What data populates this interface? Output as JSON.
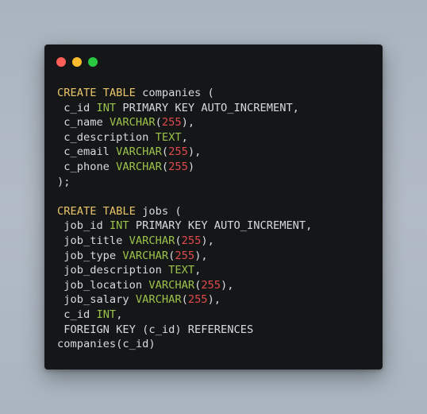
{
  "window": {
    "controls": [
      {
        "name": "close",
        "color": "#ff5f57"
      },
      {
        "name": "minimize",
        "color": "#febc2e"
      },
      {
        "name": "maximize",
        "color": "#28c840"
      }
    ]
  },
  "colors": {
    "keyword": "#e8c46a",
    "type": "#9bc24a",
    "number": "#e04b4b",
    "text": "#d7dade",
    "background": "#151618"
  },
  "code": {
    "lines": [
      [
        {
          "t": "kw",
          "v": "CREATE TABLE"
        },
        {
          "t": "pl",
          "v": " companies ("
        }
      ],
      [
        {
          "t": "pl",
          "v": " c_id "
        },
        {
          "t": "ty",
          "v": "INT"
        },
        {
          "t": "pl",
          "v": " PRIMARY KEY AUTO_INCREMENT,"
        }
      ],
      [
        {
          "t": "pl",
          "v": " c_name "
        },
        {
          "t": "ty",
          "v": "VARCHAR"
        },
        {
          "t": "pl",
          "v": "("
        },
        {
          "t": "num",
          "v": "255"
        },
        {
          "t": "pl",
          "v": "),"
        }
      ],
      [
        {
          "t": "pl",
          "v": " c_description "
        },
        {
          "t": "ty",
          "v": "TEXT"
        },
        {
          "t": "pl",
          "v": ","
        }
      ],
      [
        {
          "t": "pl",
          "v": " c_email "
        },
        {
          "t": "ty",
          "v": "VARCHAR"
        },
        {
          "t": "pl",
          "v": "("
        },
        {
          "t": "num",
          "v": "255"
        },
        {
          "t": "pl",
          "v": "),"
        }
      ],
      [
        {
          "t": "pl",
          "v": " c_phone "
        },
        {
          "t": "ty",
          "v": "VARCHAR"
        },
        {
          "t": "pl",
          "v": "("
        },
        {
          "t": "num",
          "v": "255"
        },
        {
          "t": "pl",
          "v": ")"
        }
      ],
      [
        {
          "t": "pl",
          "v": ");"
        }
      ],
      [],
      [
        {
          "t": "kw",
          "v": "CREATE TABLE"
        },
        {
          "t": "pl",
          "v": " jobs ("
        }
      ],
      [
        {
          "t": "pl",
          "v": " job_id "
        },
        {
          "t": "ty",
          "v": "INT"
        },
        {
          "t": "pl",
          "v": " PRIMARY KEY AUTO_INCREMENT,"
        }
      ],
      [
        {
          "t": "pl",
          "v": " job_title "
        },
        {
          "t": "ty",
          "v": "VARCHAR"
        },
        {
          "t": "pl",
          "v": "("
        },
        {
          "t": "num",
          "v": "255"
        },
        {
          "t": "pl",
          "v": "),"
        }
      ],
      [
        {
          "t": "pl",
          "v": " job_type "
        },
        {
          "t": "ty",
          "v": "VARCHAR"
        },
        {
          "t": "pl",
          "v": "("
        },
        {
          "t": "num",
          "v": "255"
        },
        {
          "t": "pl",
          "v": "),"
        }
      ],
      [
        {
          "t": "pl",
          "v": " job_description "
        },
        {
          "t": "ty",
          "v": "TEXT"
        },
        {
          "t": "pl",
          "v": ","
        }
      ],
      [
        {
          "t": "pl",
          "v": " job_location "
        },
        {
          "t": "ty",
          "v": "VARCHAR"
        },
        {
          "t": "pl",
          "v": "("
        },
        {
          "t": "num",
          "v": "255"
        },
        {
          "t": "pl",
          "v": "),"
        }
      ],
      [
        {
          "t": "pl",
          "v": " job_salary "
        },
        {
          "t": "ty",
          "v": "VARCHAR"
        },
        {
          "t": "pl",
          "v": "("
        },
        {
          "t": "num",
          "v": "255"
        },
        {
          "t": "pl",
          "v": "),"
        }
      ],
      [
        {
          "t": "pl",
          "v": " c_id "
        },
        {
          "t": "ty",
          "v": "INT"
        },
        {
          "t": "pl",
          "v": ","
        }
      ],
      [
        {
          "t": "pl",
          "v": " FOREIGN KEY (c_id) REFERENCES"
        }
      ],
      [
        {
          "t": "pl",
          "v": "companies(c_id)"
        }
      ]
    ]
  }
}
